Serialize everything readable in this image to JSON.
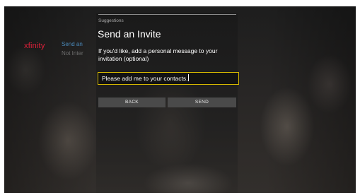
{
  "background": {
    "logo": "xfinity",
    "menu_items": [
      "Send an",
      "Not Inter"
    ]
  },
  "dialog": {
    "section": "Suggestions",
    "title": "Send an Invite",
    "description": "If you'd like, add a personal message to your invitation (optional)",
    "input_value": "Please add me to your contacts.",
    "buttons": {
      "back": "BACK",
      "send": "SEND"
    }
  },
  "colors": {
    "brand": "#e0203a",
    "focus": "#d6b800",
    "button": "#4a4a4a",
    "menu_active": "#4a88b8"
  }
}
